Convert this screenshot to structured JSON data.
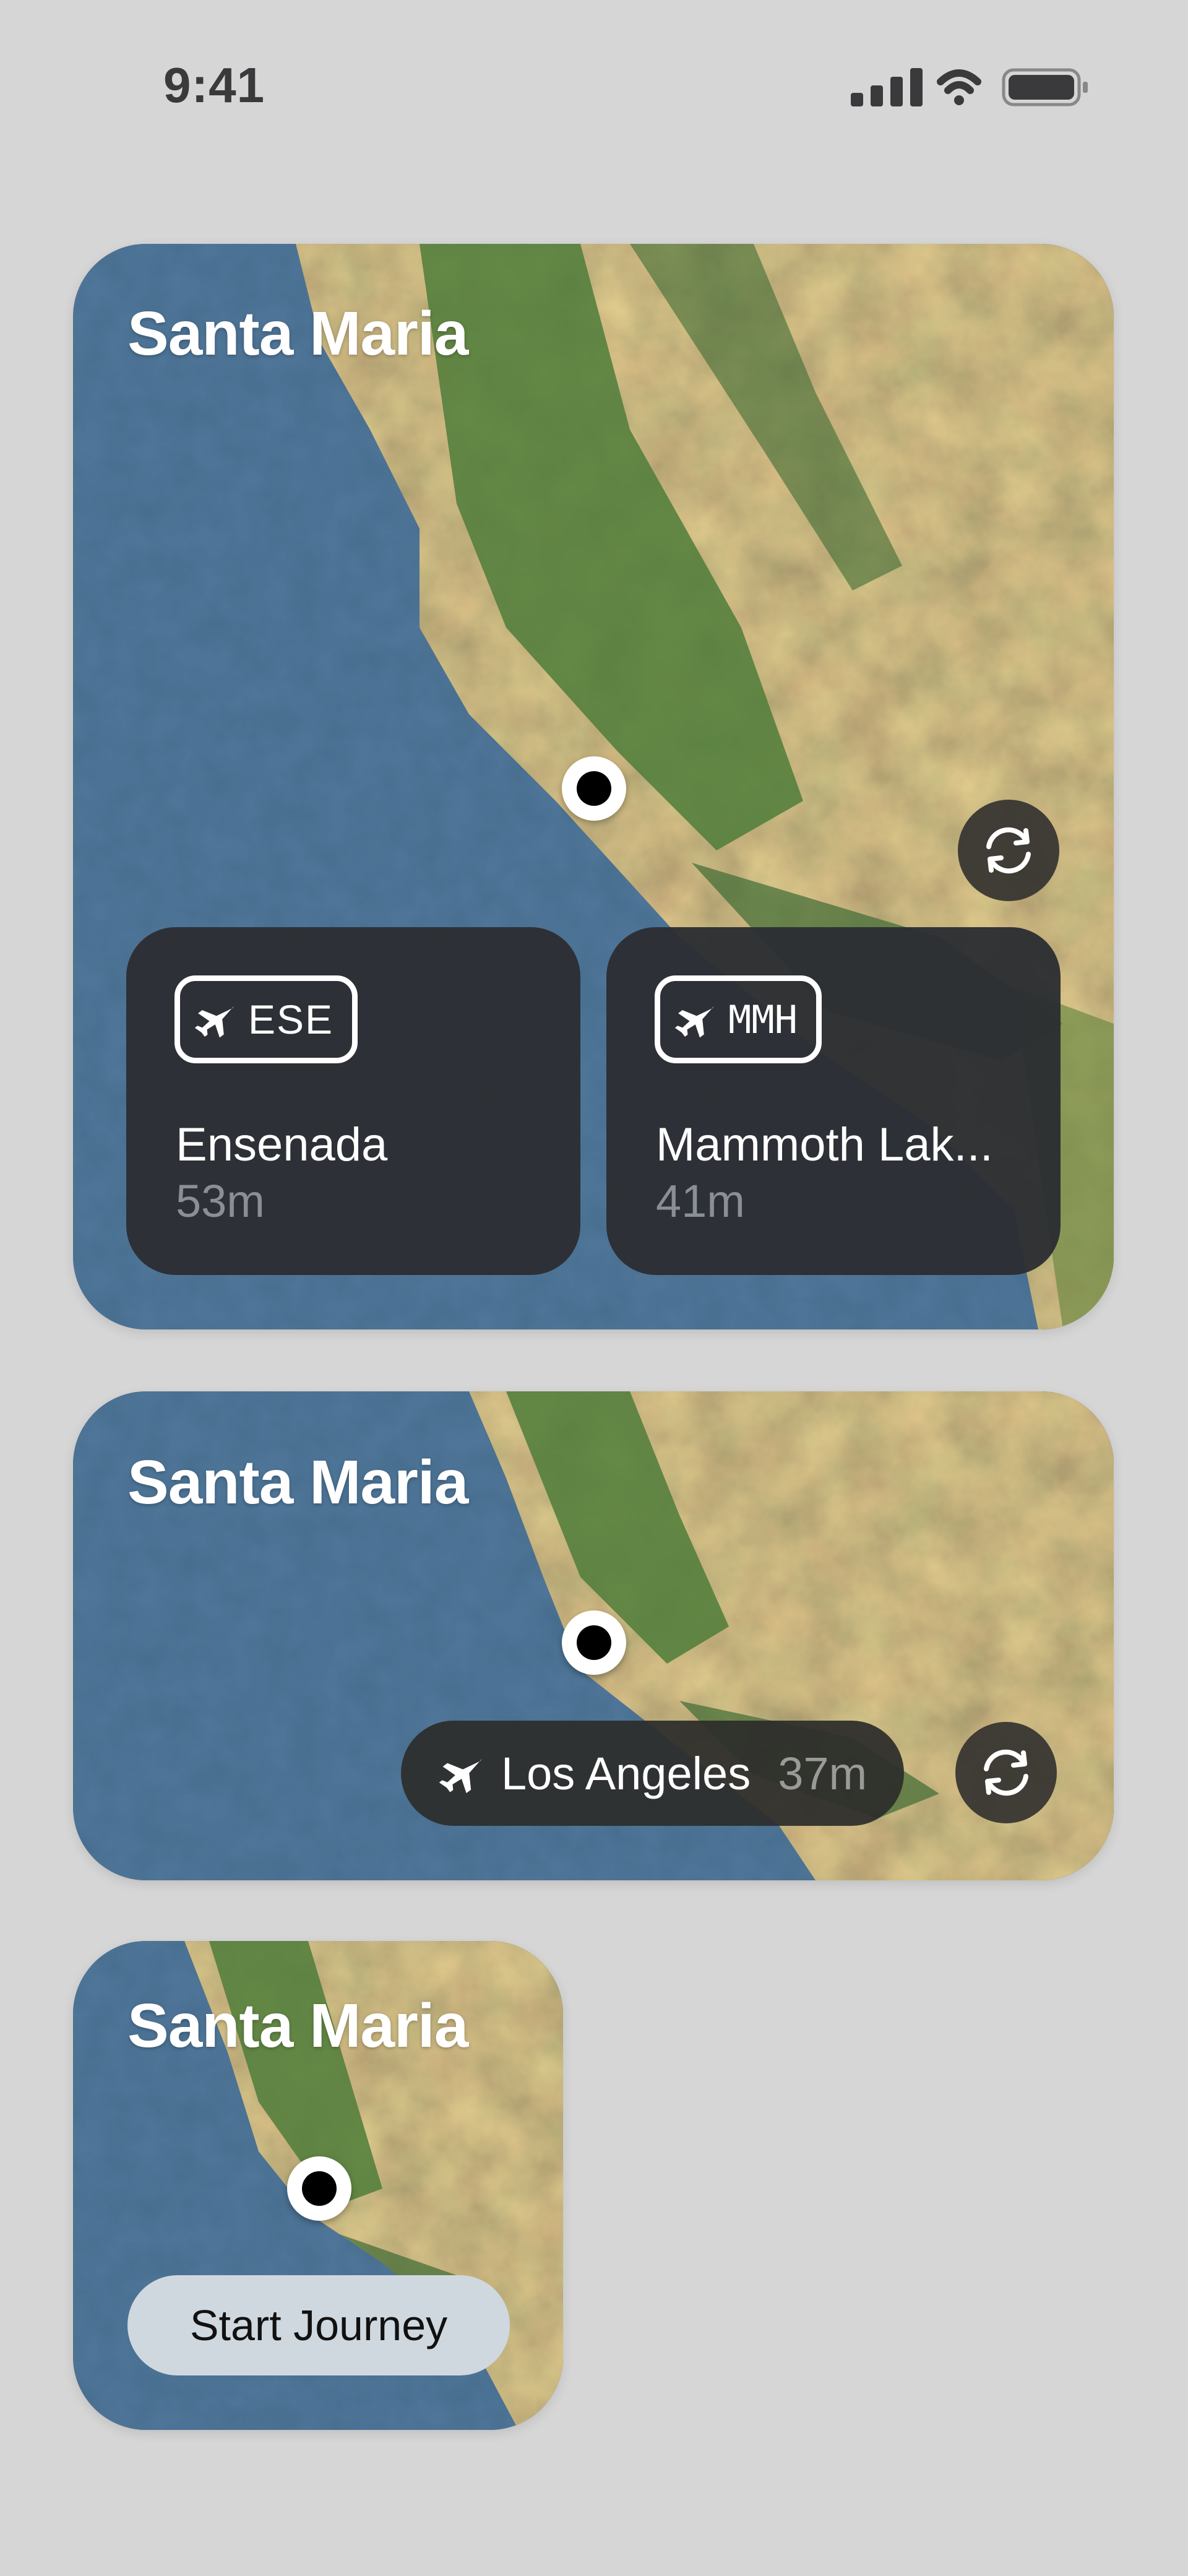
{
  "status_bar": {
    "time": "9:41"
  },
  "colors": {
    "page_bg": "#d6d6d6",
    "ocean": "#24466a",
    "land_green": "#4d7a3a",
    "land_tan": "#9b7448",
    "card": "#2c2e32"
  },
  "widget_large": {
    "title": "Santa Maria",
    "destinations": [
      {
        "code": "ESE",
        "name": "Ensenada",
        "time": "53m"
      },
      {
        "code": "MMH",
        "name": "Mammoth Lak...",
        "time": "41m"
      }
    ]
  },
  "widget_medium": {
    "title": "Santa Maria",
    "destination": {
      "name": "Los Angeles",
      "time": "37m"
    }
  },
  "widget_small": {
    "title": "Santa Maria",
    "button_label": "Start Journey"
  },
  "icons": [
    "cellular-signal-icon",
    "wifi-icon",
    "battery-icon",
    "airplane-icon",
    "refresh-icon",
    "location-pin-icon"
  ]
}
